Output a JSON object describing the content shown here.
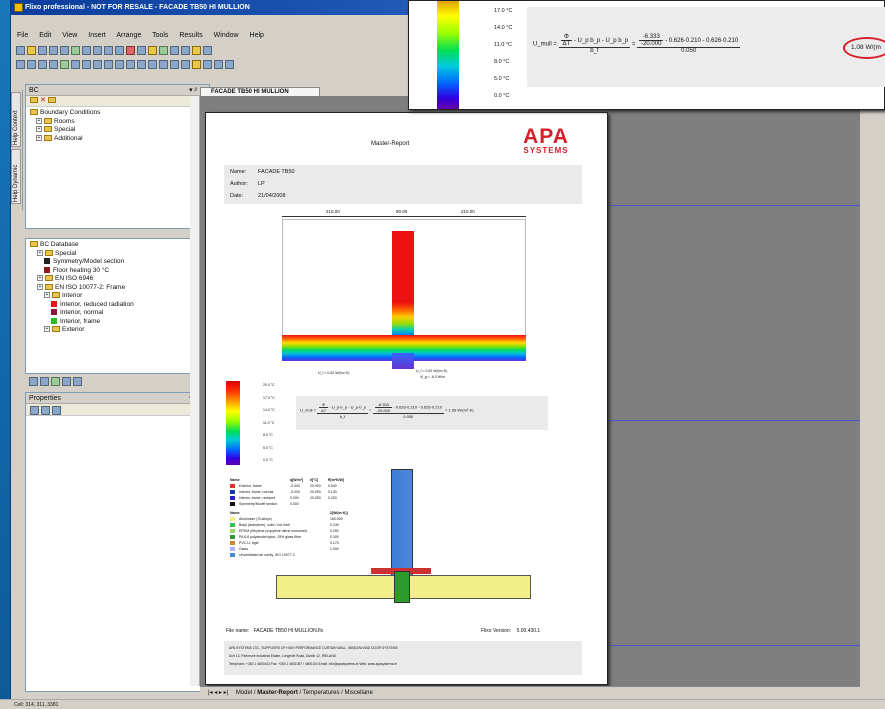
{
  "window": {
    "title": "Flixo professional - NOT FOR RESALE - FACADE TB50 HI MULLION"
  },
  "menu": [
    "File",
    "Edit",
    "View",
    "Insert",
    "Arrange",
    "Tools",
    "Results",
    "Window",
    "Help"
  ],
  "bc_panel": {
    "title": "BC",
    "tree": [
      "Boundary Conditions",
      "Rooms",
      "Special",
      "Additional"
    ]
  },
  "bc_database": {
    "root": "BC Database",
    "items": [
      {
        "label": "Special",
        "kind": "folder",
        "level": 1
      },
      {
        "label": "Symmetry/Model section",
        "kind": "swatch",
        "color": "#222222",
        "level": 2
      },
      {
        "label": "Floor heating 30 °C",
        "kind": "swatch",
        "color": "#8b1a1a",
        "level": 2
      },
      {
        "label": "EN ISO 6946",
        "kind": "folder",
        "level": 1
      },
      {
        "label": "EN ISO 10077-2: Frame",
        "kind": "folder",
        "level": 1
      },
      {
        "label": "Interior",
        "kind": "folder",
        "level": 2
      },
      {
        "label": "Interior, reduced radiation",
        "kind": "swatch",
        "color": "#e81818",
        "level": 3
      },
      {
        "label": "Interior, normal",
        "kind": "swatch",
        "color": "#8b1a3a",
        "level": 3
      },
      {
        "label": "Interior, frame",
        "kind": "swatch",
        "color": "#22c022",
        "level": 3
      },
      {
        "label": "Exterior",
        "kind": "folder",
        "level": 2
      }
    ]
  },
  "properties_panel": {
    "title": "Properties"
  },
  "side_tabs": [
    "Help Context",
    "Help Dynamic"
  ],
  "document_tab": "FACADE TB50 HI MULLION",
  "report": {
    "heading": "Master-Report",
    "logo_line1": "APA",
    "logo_line2": "SYSTEMS",
    "name_label": "Name:",
    "name_value": "FACADE TB50",
    "author_label": "Author:",
    "author_value": "LP",
    "date_label": "Date:",
    "date_value": "21/04/2008",
    "dims": [
      "210.00",
      "90.00",
      "210.00"
    ],
    "u_left": "U_f = 0.62 W/(m²·K)",
    "u_right": "U_f = 0.62 W/(m²·K)",
    "psi": "Ψ_g = -6.3 W/m",
    "temps": [
      "20.0 °C",
      "17.0 °C",
      "14.0 °C",
      "11.0 °C",
      "8.0 °C",
      "5.0 °C",
      "0.0 °C"
    ],
    "formula": {
      "lhs": "U_mull",
      "num1": "Φ",
      "den1": "ΔT",
      "tail": "- U_p·b_p - U_p·b_p",
      "den_b": "b_f",
      "num2": "-6.333",
      "den2": "-20.000",
      "mid": "- 0.626·0.210 - 0.626·0.210",
      "den3": "0.050",
      "result": "= 1.08 W/(m²·K)"
    },
    "bc_table_header": [
      "Name",
      "q[W/m²]",
      "θ[°C]",
      "R[m²K/W]"
    ],
    "bc_rows": [
      {
        "color": "#e03030",
        "name": "Exterior, frame",
        "q": "-0.000",
        "t": "20.000",
        "r": "0.040"
      },
      {
        "color": "#1a3aa8",
        "name": "Interior, frame, normal",
        "q": "-0.000",
        "t": "20.000",
        "r": "0.130"
      },
      {
        "color": "#2222cc",
        "name": "Interior, frame, reduced",
        "q": "0.000",
        "t": "20.000",
        "r": "0.200"
      },
      {
        "color": "#111111",
        "name": "Symmetry/Model section",
        "q": "0.000",
        "t": "",
        "r": ""
      }
    ],
    "mat_table_header": [
      "Name",
      "λ[W/(m·K)]"
    ],
    "mat_rows": [
      {
        "color": "#f2ee88",
        "name": "Aluminium (Si alloys)",
        "v": "160.000"
      },
      {
        "color": "#3ac048",
        "name": "Butyl (isobutene), solid / hot melt",
        "v": "0.240"
      },
      {
        "color": "#a4d46a",
        "name": "EPDM (ethylene propylene diene monomer)",
        "v": "0.250"
      },
      {
        "color": "#2c9a2c",
        "name": "PA 6.6 polyamide/nylon, 25% glass fibre",
        "v": "0.300"
      },
      {
        "color": "#cc8a2a",
        "name": "PVC-U, rigid",
        "v": "0.170"
      },
      {
        "color": "#aab4ff",
        "name": "Glass",
        "v": "1.000"
      },
      {
        "color": "#4c86d8",
        "name": "Unventilated air cavity, ISO 10077-2",
        "v": ""
      }
    ],
    "file_label": "File name:",
    "file_value": "FACADE TB50 HI MULLION.flx",
    "version_label": "Flixo Version:",
    "version_value": "5.00.430.1",
    "footer": [
      "APA SYSTEMS LTD., SUPPLIERS OF HIGH PERFORMANCE CURTAIN WALL, WINDOW AND DOOR SYSTEMS",
      "Unit 13, Parkmore Industrial Estate, Longmile Road, Dublin 12, IRELAND",
      "Telephone: +353 1 4600103   Fax: +353 1 4601057 / 4600104   Email: info@apasystems.ie   Web: www.apasystems.ie"
    ]
  },
  "popup": {
    "temps": [
      "17.0 °C",
      "14.0 °C",
      "11.0 °C",
      "8.0 °C",
      "5.0 °C",
      "0.0 °C"
    ],
    "lhs": "U_mull",
    "num1": "Φ",
    "den1": "ΔT",
    "tail": "- U_p b_p - U_p b_p",
    "den_b": "b_f",
    "num2": "-6.333",
    "den2": "-20.000",
    "mid": "- 0.626·0.210 - 0.626·0.210",
    "den3": "0.050",
    "result": "1.08 W/(m",
    "highlight": "#d4202a"
  },
  "bottom_tabs": [
    "Model",
    "Master-Report",
    "Temperatures",
    "Miscellane"
  ],
  "statusbar": "Cell: 314, 311, 3381",
  "colors": {
    "accent": "#0a3d9c",
    "apa_red": "#d4202a",
    "canvas": "#7f7f7f",
    "guide_line": "#4c57c8"
  }
}
